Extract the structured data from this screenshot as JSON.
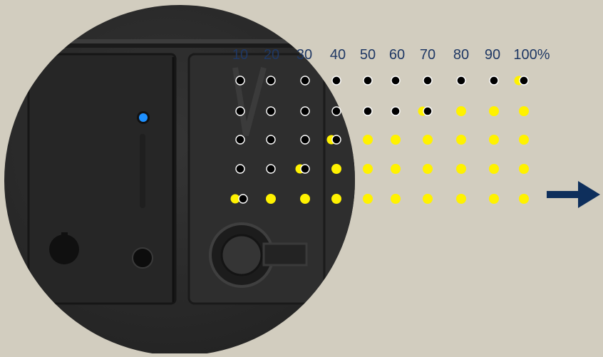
{
  "scale": {
    "labels": [
      "10",
      "20",
      "30",
      "40",
      "50",
      "60",
      "70",
      "80",
      "90",
      "100%"
    ]
  },
  "indicator": {
    "rows": 5,
    "columns": 10,
    "yellow_dot_color": "#fff200",
    "black_dot_color": "#000000",
    "black_dots_per_row_from_left": [
      10,
      7,
      4,
      3,
      1
    ],
    "led_color": "#1e90ff"
  },
  "arrow": {
    "icon": "arrow-right-icon",
    "color": "#0e2f5c"
  },
  "device": {
    "body_color": "#2b2b2b",
    "panel_color": "#1f1f1f"
  }
}
